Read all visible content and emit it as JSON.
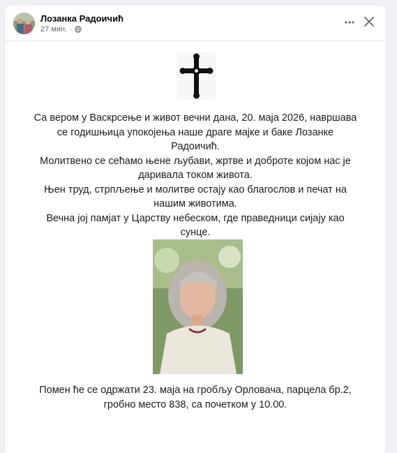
{
  "post": {
    "author": "Лозанка Радоичић",
    "time": "27 мин.",
    "separator": "·",
    "icons": {
      "privacy": "globe-icon",
      "more": "more-horizontal-icon",
      "close": "close-icon"
    }
  },
  "notice": {
    "paragraphs": [
      "Са вером у Васкрсење и живот вечни дана, 20. маја 2026, навршава се годишњица упокојења наше драге мајке и баке Лозанке Радоичић.",
      "Молитвено се сећамо њене љубави, жртве и доброте којом нас је даривала током живота.",
      "Њен труд, стрпљење и молитве остају као благослов и печат на нашим животима.",
      "Вечна јој памјат у Царству небеском, где праведници сијају као сунце."
    ],
    "memorial": "Помен ће се одржати 23. маја на гробљу Орловача, парцела бр.2, гробно место 838, са почетком у 10.00."
  },
  "colors": {
    "page_bg": "#f0f2f5",
    "card_bg": "#ffffff",
    "secondary_text": "#65676b"
  }
}
